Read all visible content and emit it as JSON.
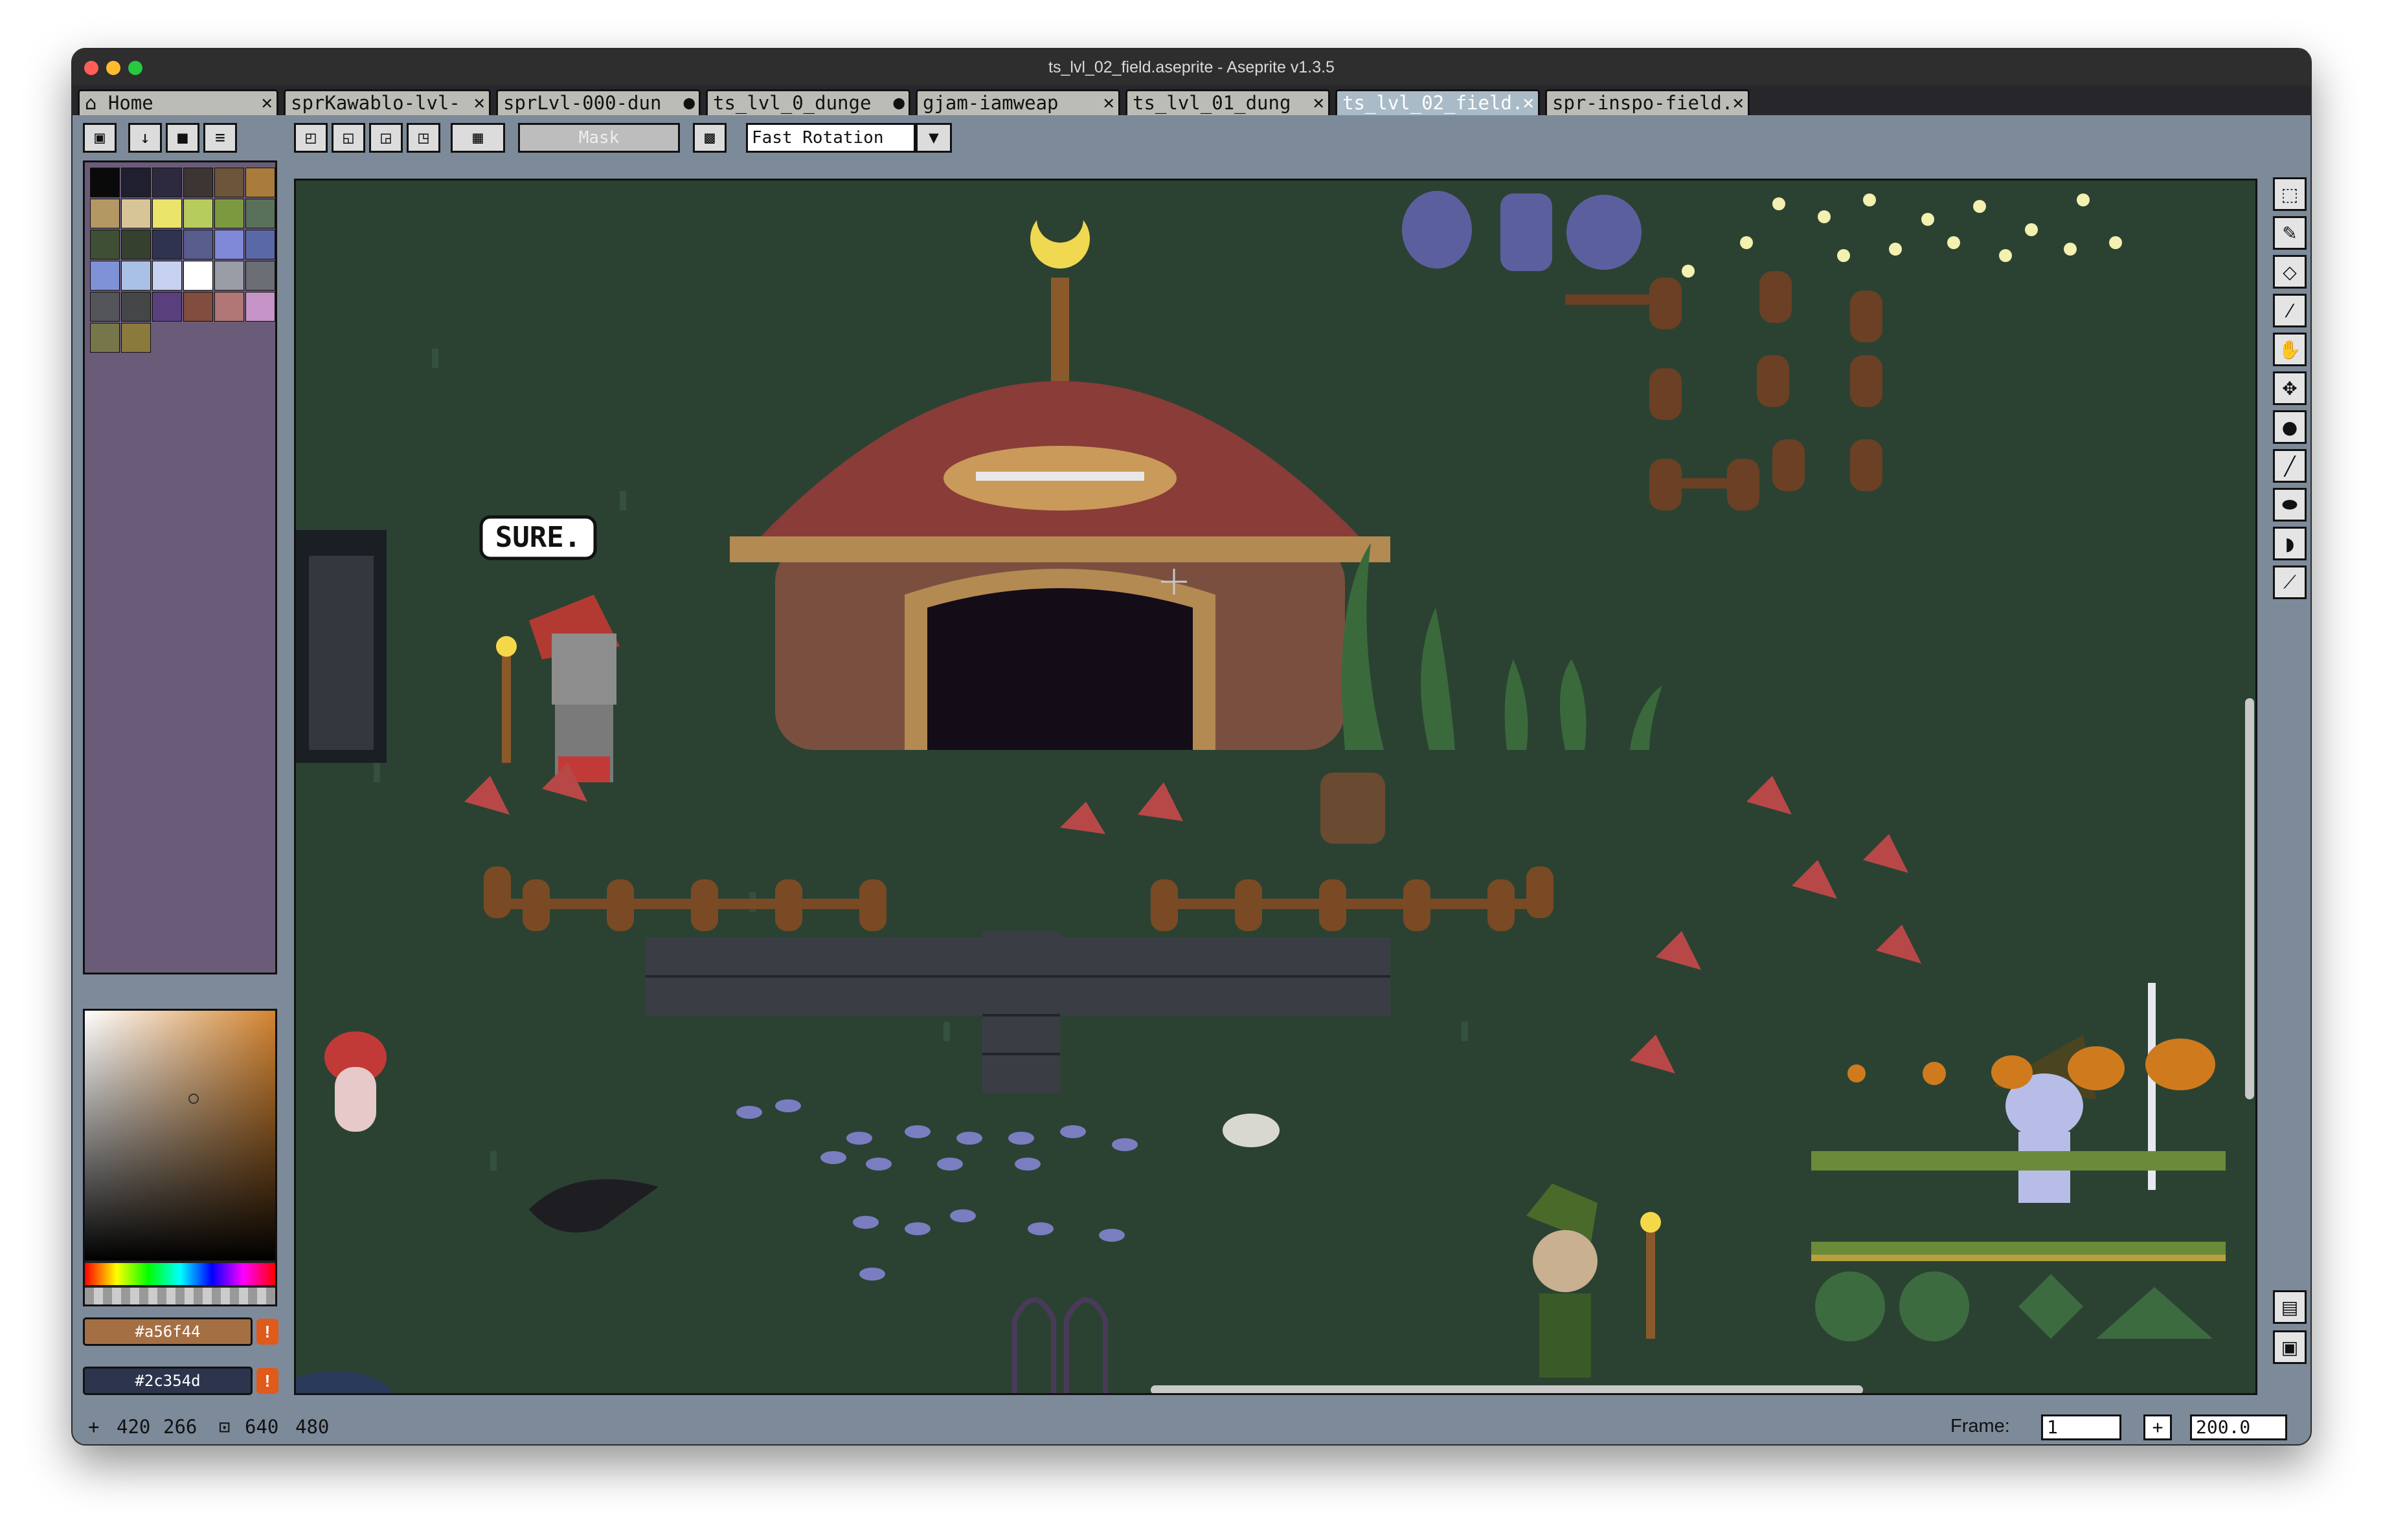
{
  "window": {
    "title": "ts_lvl_02_field.aseprite - Aseprite v1.3.5"
  },
  "tabs": [
    {
      "label": "Home",
      "active": false
    },
    {
      "label": "sprKawablo-lvl-",
      "active": false
    },
    {
      "label": "sprLvl-000-dun",
      "active": false
    },
    {
      "label": "ts_lvl_0_dunge",
      "active": false
    },
    {
      "label": "gjam-iamweap",
      "active": false
    },
    {
      "label": "ts_lvl_01_dung",
      "active": false
    },
    {
      "label": "ts_lvl_02_field.",
      "active": true
    },
    {
      "label": "spr-inspo-field.",
      "active": false
    }
  ],
  "toolbar": {
    "mask_label": "Mask",
    "rotation_label": "Fast Rotation"
  },
  "canvas": {
    "speech_bubble": "SURE."
  },
  "colors": {
    "foreground": "#a56f44",
    "background": "#2c354d",
    "accent": "#a9bbc6",
    "canvas_bg": "#2b4232"
  },
  "palette": [
    "#0a0a0a",
    "#201f30",
    "#2d2a3f",
    "#3d3534",
    "#6c553b",
    "#a97c3d",
    "#b39864",
    "#d8c597",
    "#eae46a",
    "#b6cc5c",
    "#7b9a3f",
    "#59715a",
    "#3f4f35",
    "#36402f",
    "#2f3350",
    "#585d8e",
    "#8088d8",
    "#5b68a8",
    "#7f92d7",
    "#aac1e6",
    "#c6d2ef",
    "#ffffff",
    "#989da6",
    "#6b6e75",
    "#53555b",
    "#454648",
    "#5a3f7d",
    "#814d3f",
    "#b07776",
    "#c693c6",
    "#76764b",
    "#8a7a3b"
  ],
  "status": {
    "cursor_x": "420",
    "cursor_y": "266",
    "size_w": "640",
    "size_h": "480",
    "frame_label": "Frame:",
    "frame_value": "1",
    "zoom": "200.0"
  },
  "icons": {
    "home": "home-icon",
    "lock": "lock-icon",
    "warning": "warning-icon"
  }
}
